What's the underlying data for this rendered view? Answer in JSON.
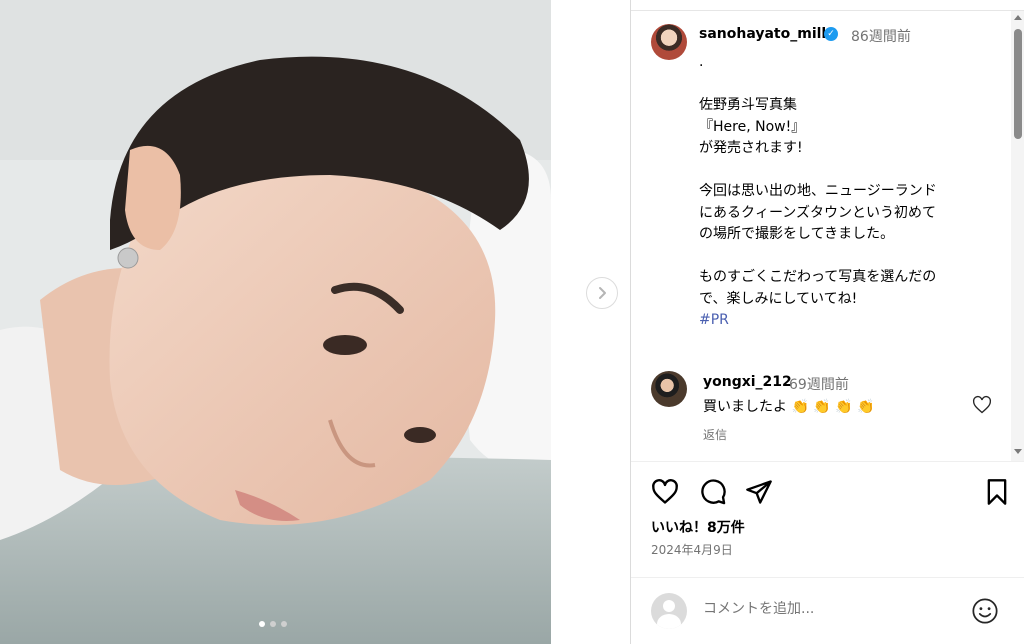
{
  "post": {
    "username": "sanohayato_milk",
    "time_ago": "86週間前",
    "caption": ".\n\n佐野勇斗写真集\n『Here, Now!』\nが発売されます!\n\n今回は思い出の地、ニュージーランド\nにあるクィーンズタウンという初めて\nの場所で撮影をしてきました。\n\nものすごくこだわって写真を選んだの\nで、楽しみにしていてね!\n",
    "hashtag": "#PR",
    "verified": true
  },
  "comments": [
    {
      "username": "yongxi_212",
      "time_ago": "69週間前",
      "text": "買いましたよ 👏 👏 👏 👏",
      "reply_label": "返信"
    }
  ],
  "engagement": {
    "likes": "いいね！8万件",
    "date": "2024年4月9日"
  },
  "comment_box": {
    "placeholder": "コメントを追加..."
  },
  "carousel": {
    "slide_count": 3,
    "active_slide": 1
  },
  "icons": {
    "like": "heart-icon",
    "comment": "comment-bubble-icon",
    "share": "paper-plane-icon",
    "save": "bookmark-icon",
    "next": "chevron-right-icon",
    "emoji": "smiley-icon"
  },
  "colors": {
    "hashtag": "#4a5fb0",
    "verified": "#1d9bf0",
    "muted_text": "#737373"
  }
}
